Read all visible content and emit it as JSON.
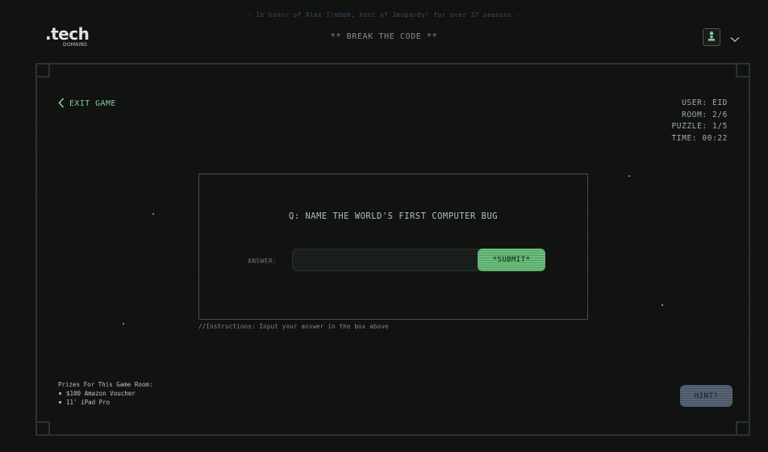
{
  "banner": {
    "tribute": "· In honor of Alex Trebek, host of Jeopardy! for over 37 seasons ·"
  },
  "header": {
    "logo_main": ".tech",
    "logo_sub": "DOMAINS",
    "title": "** BREAK THE CODE **"
  },
  "nav": {
    "exit_label": "EXIT GAME"
  },
  "stats": {
    "user": "USER: EID",
    "room": "ROOM: 2/6",
    "puzzle": "PUZZLE: 1/5",
    "time": "TIME: 00:22"
  },
  "puzzle": {
    "question": "Q: NAME THE WORLD'S FIRST COMPUTER BUG",
    "answer_label": "ANSWER:",
    "answer_value": "",
    "submit_label": "*SUBMIT*",
    "instructions": "//Instructions: Input your answer in the box above"
  },
  "prizes": {
    "heading": "Prizes For This Game Room:",
    "items": [
      "$100 Amazon Voucher",
      "11' iPad Pro"
    ]
  },
  "hint": {
    "label": "HINT?"
  },
  "colors": {
    "background": "#121412",
    "accent_green": "#6bbf7d",
    "exit_green": "#8fd9a3",
    "hint_button": "#566475",
    "frame": "#2f3733"
  },
  "icons": {
    "user": "user-chess-pawn-icon",
    "chevron": "chevron-down-icon",
    "back": "chevron-left-icon"
  }
}
